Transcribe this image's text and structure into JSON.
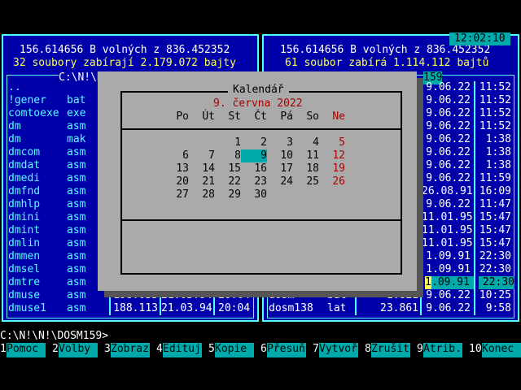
{
  "clock": "12:02:10",
  "left_panel": {
    "free_line": "156.614656 B volných z 836.452352",
    "used_line": "32 soubory zabírají 2.179.072 bajty",
    "path": "C:\\N!\\N!",
    "files": [
      {
        "name": "..",
        "ext": ""
      },
      {
        "name": "!gener",
        "ext": "bat"
      },
      {
        "name": "comtoexe",
        "ext": "exe"
      },
      {
        "name": "dm",
        "ext": "asm"
      },
      {
        "name": "dm",
        "ext": "mak"
      },
      {
        "name": "dmcom",
        "ext": "asm"
      },
      {
        "name": "dmdat",
        "ext": "asm"
      },
      {
        "name": "dmedi",
        "ext": "asm"
      },
      {
        "name": "dmfnd",
        "ext": "asm"
      },
      {
        "name": "dmhlp",
        "ext": "asm"
      },
      {
        "name": "dmini",
        "ext": "asm"
      },
      {
        "name": "dmint",
        "ext": "asm"
      },
      {
        "name": "dmlin",
        "ext": "asm"
      },
      {
        "name": "dmmen",
        "ext": "asm"
      },
      {
        "name": "dmsel",
        "ext": "asm"
      },
      {
        "name": "dmtre",
        "ext": "asm"
      },
      {
        "name": "dmuse",
        "ext": "asm",
        "size": "198.033",
        "date": "21.03.94",
        "time": "20:04"
      },
      {
        "name": "dmuse1",
        "ext": "asm",
        "size": "188.113",
        "date": "21.03.94",
        "time": "20:04"
      }
    ]
  },
  "right_panel": {
    "free_line": "156.614656 B volných z 836.452352",
    "used_line": "61 soubor zabírá 1.114.112 bajtů",
    "path_fragment": "159",
    "rows": [
      {
        "date": "9.06.22",
        "time": "11:52"
      },
      {
        "date": "9.06.22",
        "time": "11:52"
      },
      {
        "date": "9.06.22",
        "time": "11:52"
      },
      {
        "date": "9.06.22",
        "time": "11:52"
      },
      {
        "date": "9.06.22",
        "time": "1:38"
      },
      {
        "date": "9.06.22",
        "time": "1:38"
      },
      {
        "date": "9.06.22",
        "time": "1:38"
      },
      {
        "date": "9.06.22",
        "time": "11:59"
      },
      {
        "date": "26.08.91",
        "time": "16:09"
      },
      {
        "date": "9.06.22",
        "time": "11:47"
      },
      {
        "date": "11.01.95",
        "time": "15:47"
      },
      {
        "date": "11.01.95",
        "time": "15:47"
      },
      {
        "date": "11.01.95",
        "time": "15:47"
      },
      {
        "date": "1.09.91",
        "time": "22:30"
      },
      {
        "date": "1.09.91",
        "time": "22:30"
      },
      {
        "date": "1.09.91",
        "time": "22:30"
      },
      {
        "name": "dosm",
        "ext": "bat",
        "size": "1.821",
        "date": "9.06.22",
        "time": "10:25"
      },
      {
        "name": "dosm138",
        "ext": "lat",
        "size": "23.861",
        "date": "9.06.22",
        "time": "9:58"
      }
    ],
    "cursor_date_prefix": "1",
    "cursor_date": ".09.91",
    "cursor_time": "22:30"
  },
  "calendar": {
    "title": "Kalendář",
    "date_heading": "9. června 2022",
    "weekdays": [
      "Po",
      "Út",
      "St",
      "Čt",
      "Pá",
      "So",
      "Ne"
    ],
    "weeks": [
      [
        "",
        "",
        "1",
        "2",
        "3",
        "4",
        "5"
      ],
      [
        "6",
        "7",
        "8",
        "9",
        "10",
        "11",
        "12"
      ],
      [
        "13",
        "14",
        "15",
        "16",
        "17",
        "18",
        "19"
      ],
      [
        "20",
        "21",
        "22",
        "23",
        "24",
        "25",
        "26"
      ],
      [
        "27",
        "28",
        "29",
        "30",
        "",
        "",
        ""
      ]
    ],
    "today": "9",
    "colors": {
      "sunday": "#aa0000",
      "today_bg": "#00aaaa"
    }
  },
  "prompt": "C:\\N!\\N!\\DOSM159>",
  "function_keys": [
    {
      "num": "1",
      "label": "Pomoc"
    },
    {
      "num": "2",
      "label": "Volby"
    },
    {
      "num": "3",
      "label": "Zobraz"
    },
    {
      "num": "4",
      "label": "Edituj"
    },
    {
      "num": "5",
      "label": "Kopie"
    },
    {
      "num": "6",
      "label": "Přesuň"
    },
    {
      "num": "7",
      "label": "Vytvoř"
    },
    {
      "num": "8",
      "label": "Zrušit"
    },
    {
      "num": "9",
      "label": "Atrib."
    },
    {
      "num": "10",
      "label": "Konec"
    }
  ]
}
